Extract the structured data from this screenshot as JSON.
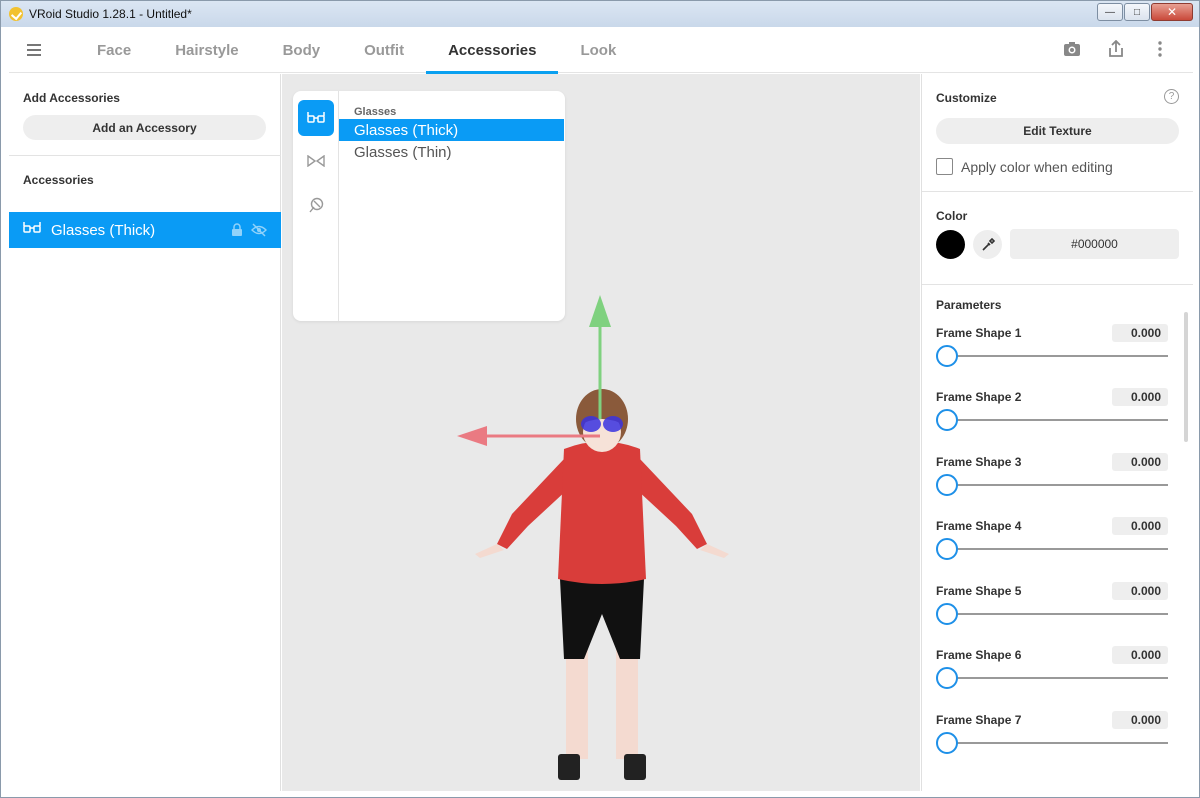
{
  "window": {
    "title": "VRoid Studio 1.28.1 - Untitled*"
  },
  "nav": {
    "tabs": [
      {
        "label": "Face",
        "active": false
      },
      {
        "label": "Hairstyle",
        "active": false
      },
      {
        "label": "Body",
        "active": false
      },
      {
        "label": "Outfit",
        "active": false
      },
      {
        "label": "Accessories",
        "active": true
      },
      {
        "label": "Look",
        "active": false
      }
    ],
    "icons": [
      "camera-icon",
      "export-icon",
      "more-vertical-icon"
    ]
  },
  "left_panel": {
    "add_section_title": "Add Accessories",
    "add_button_label": "Add an Accessory",
    "list_title": "Accessories",
    "items": [
      {
        "label": "Glasses (Thick)",
        "selected": true
      }
    ]
  },
  "picker": {
    "categories": [
      "glasses-icon",
      "bowtie-icon",
      "pin-icon"
    ],
    "heading": "Glasses",
    "options": [
      {
        "label": "Glasses (Thick)",
        "selected": true
      },
      {
        "label": "Glasses (Thin)",
        "selected": false
      }
    ]
  },
  "right_panel": {
    "customize_title": "Customize",
    "edit_texture_label": "Edit Texture",
    "apply_color_label": "Apply color when editing",
    "apply_color_checked": false,
    "color_title": "Color",
    "color_hex": "#000000",
    "parameters_title": "Parameters",
    "parameters": [
      {
        "label": "Frame Shape 1",
        "value": "0.000"
      },
      {
        "label": "Frame Shape 2",
        "value": "0.000"
      },
      {
        "label": "Frame Shape 3",
        "value": "0.000"
      },
      {
        "label": "Frame Shape 4",
        "value": "0.000"
      },
      {
        "label": "Frame Shape 5",
        "value": "0.000"
      },
      {
        "label": "Frame Shape 6",
        "value": "0.000"
      },
      {
        "label": "Frame Shape 7",
        "value": "0.000"
      }
    ]
  },
  "colors": {
    "accent": "#0a9bf5",
    "gizmo_y": "#7fd17f",
    "gizmo_x": "#ea7a82",
    "hoodie": "#d93d3a"
  }
}
